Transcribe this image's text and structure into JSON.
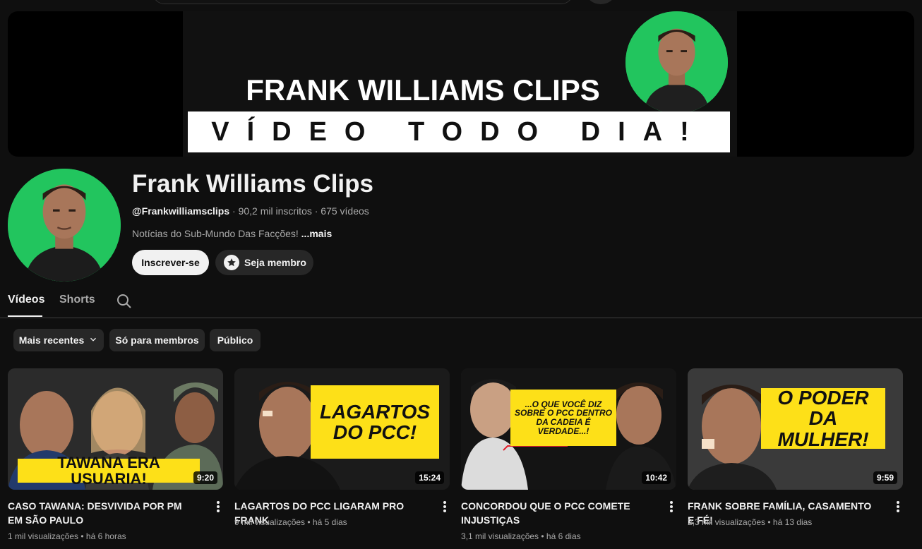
{
  "banner": {
    "title": "FRANK WILLIAMS CLIPS",
    "tagline": "VÍDEO TODO DIA!"
  },
  "channel": {
    "name": "Frank Williams Clips",
    "handle": "@Frankwilliamsclips",
    "stats": " · 90,2 mil inscritos · 675 vídeos",
    "description": "Notícias do Sub-Mundo Das Facções!",
    "more": "...mais",
    "subscribe_label": "Inscrever-se",
    "member_label": "Seja membro"
  },
  "tabs": {
    "videos": "Vídeos",
    "shorts": "Shorts"
  },
  "filters": {
    "recent": "Mais recentes",
    "members_only": "Só para membros",
    "public": "Público"
  },
  "videos": [
    {
      "title": "CASO TAWANA: DESVIVIDA POR PM EM SÃO PAULO",
      "views": "1 mil visualizações",
      "age": "há 6 horas",
      "duration": "9:20",
      "thumb_text": "TAWANA ERA USUARIA!"
    },
    {
      "title": "LAGARTOS DO PCC LIGARAM PRO FRANK",
      "views": "9 mil visualizações",
      "age": "há 5 dias",
      "duration": "15:24",
      "thumb_text": "LAGARTOS DO PCC!"
    },
    {
      "title": "CONCORDOU QUE O PCC COMETE INJUSTIÇAS",
      "views": "3,1 mil visualizações",
      "age": "há 6 dias",
      "duration": "10:42",
      "thumb_text": "...O QUE VOCÊ DIZ SOBRE O PCC DENTRO DA CADEIA É VERDADE...!"
    },
    {
      "title": "FRANK SOBRE FAMÍLIA, CASAMENTO E FÉ!",
      "views": "2,3 mil visualizações",
      "age": "há 13 dias",
      "duration": "9:59",
      "thumb_text": "O PODER DA MULHER!"
    }
  ],
  "colors": {
    "background": "#0f0f0f",
    "avatar_green": "#22c55e",
    "thumb_yellow": "#fde018"
  }
}
